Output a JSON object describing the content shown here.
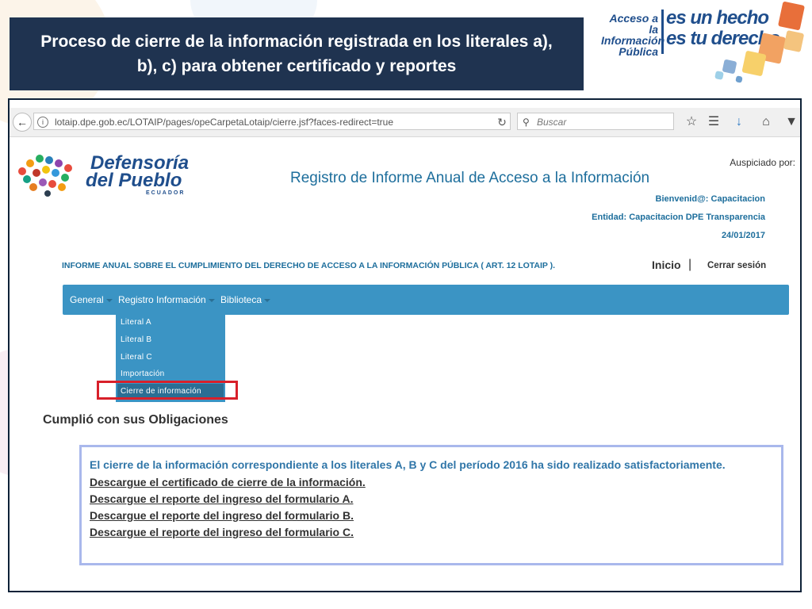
{
  "slide": {
    "title": "Proceso de cierre de la información registrada en los literales a), b), c) para obtener certificado y reportes"
  },
  "logo": {
    "left_text": "Acceso a la Información Pública",
    "right_line1": "es un hecho",
    "right_line2": "es tu derecho"
  },
  "browser": {
    "url": "lotaip.dpe.gob.ec/LOTAIP/pages/opeCarpetaLotaip/cierre.jsf?faces-redirect=true",
    "search_placeholder": "Buscar"
  },
  "site": {
    "logo_line1": "Defensoría",
    "logo_line2": "del Pueblo",
    "logo_country": "ECUADOR",
    "auspiciado": "Auspiciado por:",
    "title": "Registro de Informe Anual de Acceso a la Información",
    "welcome": "Bienvenid@: Capacitacion",
    "entity": "Entidad: Capacitacion DPE Transparencia",
    "date": "24/01/2017",
    "informe": "INFORME ANUAL SOBRE EL CUMPLIMIENTO DEL DERECHO DE ACCESO A LA INFORMACIÓN PÚBLICA ( ART. 12 LOTAIP ).",
    "inicio": "Inicio",
    "separator": "|",
    "logout": "Cerrar sesión"
  },
  "nav": {
    "items": [
      {
        "label": "General"
      },
      {
        "label": "Registro Información"
      },
      {
        "label": "Biblioteca"
      }
    ],
    "dropdown": [
      {
        "label": "Literal A"
      },
      {
        "label": "Literal B"
      },
      {
        "label": "Literal C"
      },
      {
        "label": "Importación"
      },
      {
        "label": "Cierre de información"
      }
    ]
  },
  "content": {
    "heading": "Cumplió con sus Obligaciones",
    "message": "El cierre de la información correspondiente a los literales A, B y C del período 2016 ha sido realizado satisfactoriamente.",
    "links": [
      "Descargue el certificado de cierre de la información.",
      "Descargue el reporte del ingreso del formulario A.",
      "Descargue el reporte del ingreso del formulario B.",
      "Descargue el reporte del ingreso del formulario C."
    ]
  },
  "colors": {
    "title_bg": "#1f3350",
    "nav_bg": "#3b94c4",
    "highlight": "#d8202a",
    "link_blue": "#1d6e9c"
  }
}
